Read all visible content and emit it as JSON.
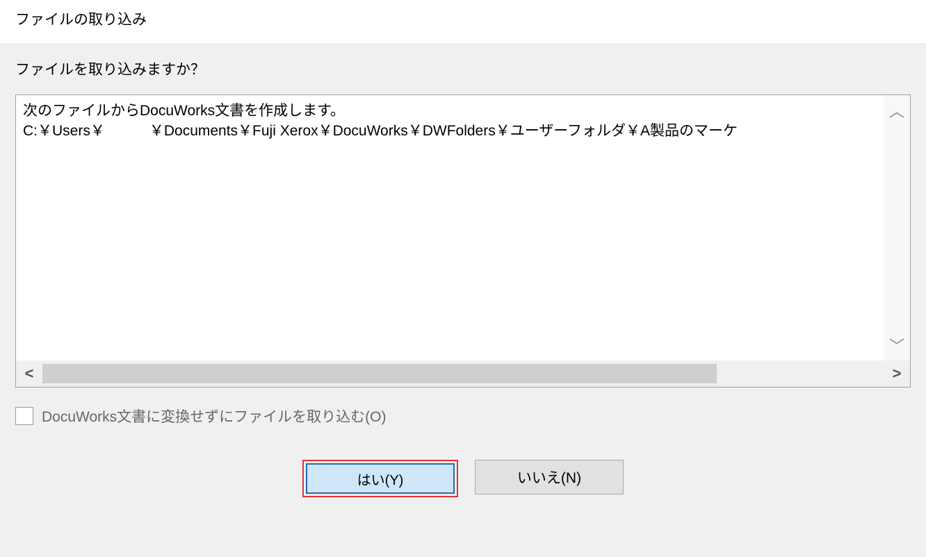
{
  "dialog": {
    "title": "ファイルの取り込み",
    "question": "ファイルを取り込みますか？",
    "message_line1": "次のファイルからDocuWorks文書を作成します。",
    "message_line2_prefix": "C:￥Users￥",
    "message_line2_suffix": "￥Documents￥Fuji Xerox￥DocuWorks￥DWFolders￥ユーザーフォルダ￥A製品のマーケ",
    "checkbox_label": "DocuWorks文書に変換せずにファイルを取り込む(O)",
    "checkbox_checked": false,
    "buttons": {
      "yes": "はい(Y)",
      "no": "いいえ(N)"
    }
  }
}
